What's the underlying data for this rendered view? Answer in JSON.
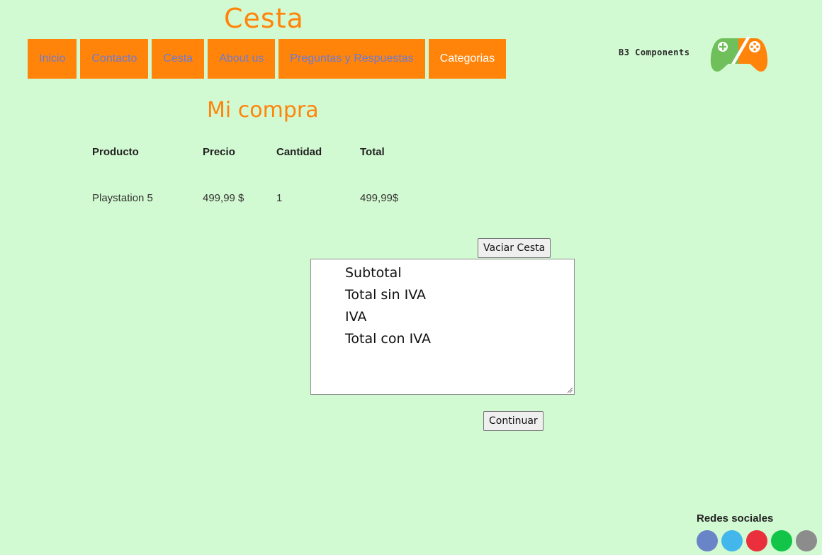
{
  "header": {
    "title": "Cesta"
  },
  "nav": {
    "items": [
      {
        "label": "Inicio"
      },
      {
        "label": "Contacto"
      },
      {
        "label": "Cesta"
      },
      {
        "label": "About us"
      },
      {
        "label": "Preguntas y Respuestas"
      },
      {
        "label": "Categorias"
      }
    ]
  },
  "logo": {
    "text": "B3 Components"
  },
  "main": {
    "title": "Mi compra",
    "table": {
      "headers": [
        "Producto",
        "Precio",
        "Cantidad",
        "Total"
      ],
      "rows": [
        [
          "Playstation 5",
          "499,99 $",
          "1",
          "499,99$"
        ]
      ]
    },
    "empty_button": "Vaciar Cesta",
    "summary": [
      "Subtotal",
      "Total sin IVA",
      "IVA",
      "Total con IVA"
    ],
    "continue_button": "Continuar"
  },
  "social": {
    "label": "Redes sociales",
    "icons": [
      {
        "name": "social-icon-1",
        "color": "#6a84c8"
      },
      {
        "name": "social-icon-2",
        "color": "#43b6ec"
      },
      {
        "name": "social-icon-3",
        "color": "#e9303c"
      },
      {
        "name": "social-icon-4",
        "color": "#12c548"
      },
      {
        "name": "social-icon-5",
        "color": "#8c8c8c"
      }
    ]
  },
  "colors": {
    "background": "#d2fad2",
    "accent": "#ff8409",
    "nav_link": "#6b7bd6"
  }
}
